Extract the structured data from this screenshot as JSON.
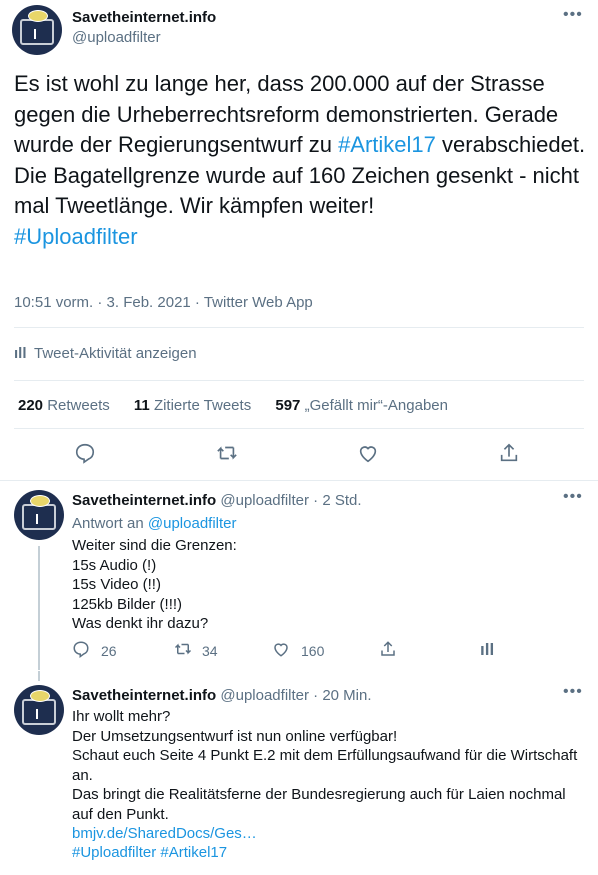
{
  "main_tweet": {
    "display_name": "Savetheinternet.info",
    "handle": "@uploadfilter",
    "text": "Es ist wohl zu lange her, dass 200.000 auf der Strasse gegen die Urheberrechtsreform demonstrierten. Gerade wurde der Regierungsentwurf zu ",
    "hashtag_inline": "#Artikel17",
    "text_after": " verabschiedet. Die Bagatellgrenze wurde auf 160 Zeichen gesenkt - nicht mal Tweetlänge. Wir kämpfen weiter!",
    "hashtag_end": "#Uploadfilter",
    "meta": "10:51 vorm. · 3. Feb. 2021 · Twitter Web App",
    "activity_label": "Tweet-Aktivität anzeigen",
    "retweets_count": "220",
    "retweets_label": "Retweets",
    "quotes_count": "11",
    "quotes_label": "Zitierte Tweets",
    "likes_count": "597",
    "likes_label": "„Gefällt mir“-Angaben"
  },
  "replies": [
    {
      "display_name": "Savetheinternet.info",
      "handle": "@uploadfilter",
      "time": "· 2 Std.",
      "reply_to_label": "Antwort an",
      "reply_to_handle": "@uploadfilter",
      "body": "Weiter sind die Grenzen:\n15s Audio (!)\n15s Video (!!)\n125kb Bilder (!!!)\nWas denkt ihr dazu?",
      "reply_count": "26",
      "retweet_count": "34",
      "like_count": "160"
    },
    {
      "display_name": "Savetheinternet.info",
      "handle": "@uploadfilter",
      "time": "· 20 Min.",
      "body": "Ihr wollt mehr?\nDer Umsetzungsentwurf ist nun online verfügbar!\nSchaut euch Seite 4 Punkt E.2 mit dem Erfüllungsaufwand für die Wirtschaft an.\nDas bringt die Realitätsferne der Bundesregierung auch für Laien nochmal auf den Punkt.",
      "link": "bmjv.de/SharedDocs/Ges…",
      "hashtags": "#Uploadfilter #Artikel17"
    }
  ],
  "icons": {
    "more": "more-horizontal-icon",
    "reply": "reply-icon",
    "retweet": "retweet-icon",
    "like": "heart-icon",
    "share": "share-icon",
    "analytics": "analytics-icon"
  },
  "colors": {
    "link": "#1b95e0",
    "secondary_text": "#5b7083",
    "divider": "#e6ecf0"
  }
}
